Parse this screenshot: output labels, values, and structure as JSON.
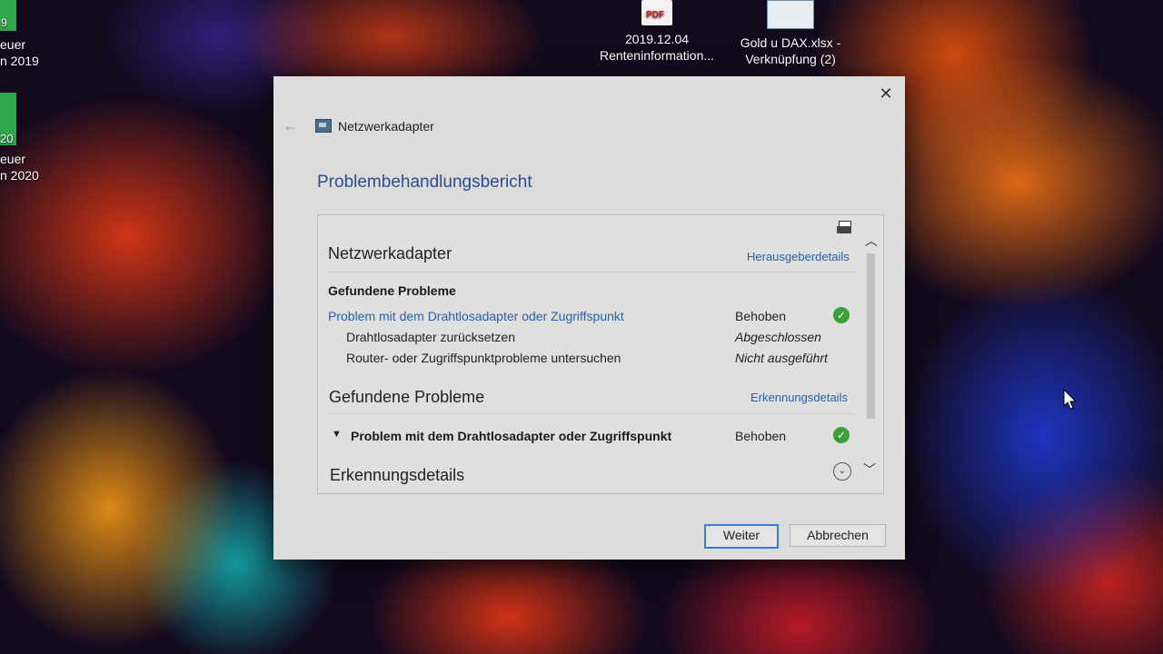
{
  "desktop": {
    "left_icon_1": {
      "line1": "euer",
      "line2": "n 2019",
      "badge": "9"
    },
    "left_icon_2": {
      "line1": "euer",
      "line2": "n 2020",
      "badge": "20"
    },
    "pdf_icon": {
      "badge": "PDF",
      "line1": "2019.12.04",
      "line2": "Renteninformation..."
    },
    "xlsx_icon": {
      "line1": "Gold u DAX.xlsx -",
      "line2": "Verknüpfung (2)"
    }
  },
  "dialog": {
    "app_title": "Netzwerkadapter",
    "heading": "Problembehandlungsbericht",
    "close_glyph": "✕",
    "back_glyph": "←",
    "report": {
      "section1_title": "Netzwerkadapter",
      "publisher_link": "Herausgeberdetails",
      "found_problems_label": "Gefundene Probleme",
      "problem_link": "Problem mit dem Drahtlosadapter oder Zugriffspunkt",
      "problem_status": "Behoben",
      "steps": [
        {
          "label": "Drahtlosadapter zurücksetzen",
          "status": "Abgeschlossen"
        },
        {
          "label": "Router- oder Zugriffspunktprobleme untersuchen",
          "status": "Nicht ausgeführt"
        }
      ],
      "section2_title": "Gefundene Probleme",
      "detection_link": "Erkennungsdetails",
      "expanded_problem": "Problem mit dem Drahtlosadapter oder Zugriffspunkt",
      "expanded_status": "Behoben",
      "section3_title": "Erkennungsdetails"
    },
    "buttons": {
      "next": "Weiter",
      "cancel": "Abbrechen"
    }
  },
  "colors": {
    "link": "#2a5fa8",
    "heading": "#2a4d8f",
    "success": "#3aa13a"
  }
}
